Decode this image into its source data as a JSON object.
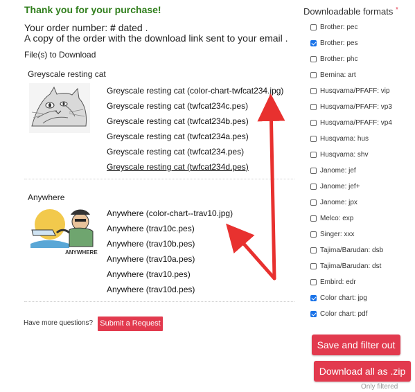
{
  "header": {
    "thanks": "Thank you for your purchase!",
    "order_prefix": "Your order number:",
    "order_number": "#",
    "order_dated": "dated .",
    "email_note": "A copy of the order with the download link sent to your email .",
    "files_heading": "File(s) to Download"
  },
  "products": [
    {
      "title": "Greyscale resting cat",
      "files": [
        "Greyscale resting cat (color-chart-twfcat234.jpg)",
        "Greyscale resting cat (twfcat234c.pes)",
        "Greyscale resting cat (twfcat234b.pes)",
        "Greyscale resting cat (twfcat234a.pes)",
        "Greyscale resting cat (twfcat234.pes)",
        "Greyscale resting cat (twfcat234d.pes)"
      ]
    },
    {
      "title": "Anywhere",
      "thumb_text": "ANYWHERE",
      "files": [
        "Anywhere (color-chart--trav10.jpg)",
        "Anywhere (trav10c.pes)",
        "Anywhere (trav10b.pes)",
        "Anywhere (trav10a.pes)",
        "Anywhere (trav10.pes)",
        "Anywhere (trav10d.pes)"
      ]
    }
  ],
  "help": {
    "question": "Have more questions?",
    "submit_label": "Submit a Request"
  },
  "formats": {
    "title": "Downloadable formats",
    "required_mark": "*",
    "items": [
      {
        "label": "Brother: pec",
        "checked": false
      },
      {
        "label": "Brother: pes",
        "checked": true
      },
      {
        "label": "Brother: phc",
        "checked": false
      },
      {
        "label": "Bernina: art",
        "checked": false
      },
      {
        "label": "Husqvarna/PFAFF: vip",
        "checked": false
      },
      {
        "label": "Husqvarna/PFAFF: vp3",
        "checked": false
      },
      {
        "label": "Husqvarna/PFAFF: vp4",
        "checked": false
      },
      {
        "label": "Husqvarna: hus",
        "checked": false
      },
      {
        "label": "Husqvarna: shv",
        "checked": false
      },
      {
        "label": "Janome: jef",
        "checked": false
      },
      {
        "label": "Janome: jef+",
        "checked": false
      },
      {
        "label": "Janome: jpx",
        "checked": false
      },
      {
        "label": "Melco: exp",
        "checked": false
      },
      {
        "label": "Singer: xxx",
        "checked": false
      },
      {
        "label": "Tajima/Barudan: dsb",
        "checked": false
      },
      {
        "label": "Tajima/Barudan: dst",
        "checked": false
      },
      {
        "label": "Embird: edr",
        "checked": false
      },
      {
        "label": "Color chart: jpg",
        "checked": true
      },
      {
        "label": "Color chart: pdf",
        "checked": true
      }
    ]
  },
  "actions": {
    "save_label": "Save and filter out",
    "zip_label": "Download all as .zip",
    "only_filtered": "Only filtered"
  },
  "colors": {
    "accent": "#e23a4e",
    "thanks_green": "#2e7d1a",
    "annotation_arrow": "#e8312f",
    "checkbox_blue": "#1a73e8"
  }
}
